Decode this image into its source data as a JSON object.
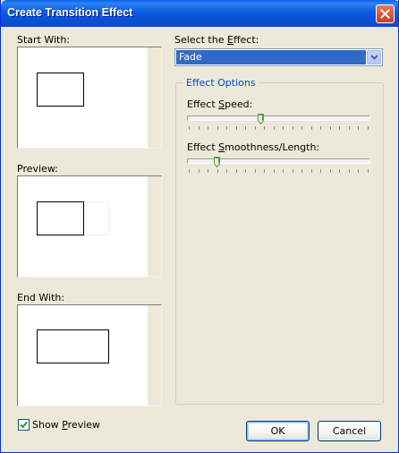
{
  "window": {
    "title": "Create Transition Effect"
  },
  "left": {
    "start_label": "Start With:",
    "preview_label": "Preview:",
    "end_label": "End With:"
  },
  "effect": {
    "select_label_before": "Select the ",
    "select_label_accel": "E",
    "select_label_after": "ffect:",
    "selected": "Fade"
  },
  "options": {
    "group_title": "Effect Options",
    "speed_label_before": "Effect ",
    "speed_label_accel": "S",
    "speed_label_after": "peed:",
    "speed_value": 0.4,
    "smooth_label_before": "Effect ",
    "smooth_label_accel": "S",
    "smooth_label_after": "moothness/Length:",
    "smooth_value": 0.15
  },
  "footer": {
    "show_preview_before": "Show ",
    "show_preview_accel": "P",
    "show_preview_after": "review",
    "show_preview_checked": true,
    "ok_label": "OK",
    "cancel_label": "Cancel"
  },
  "icons": {
    "close": "close-icon",
    "dropdown": "chevron-down-icon",
    "check": "check-icon"
  }
}
